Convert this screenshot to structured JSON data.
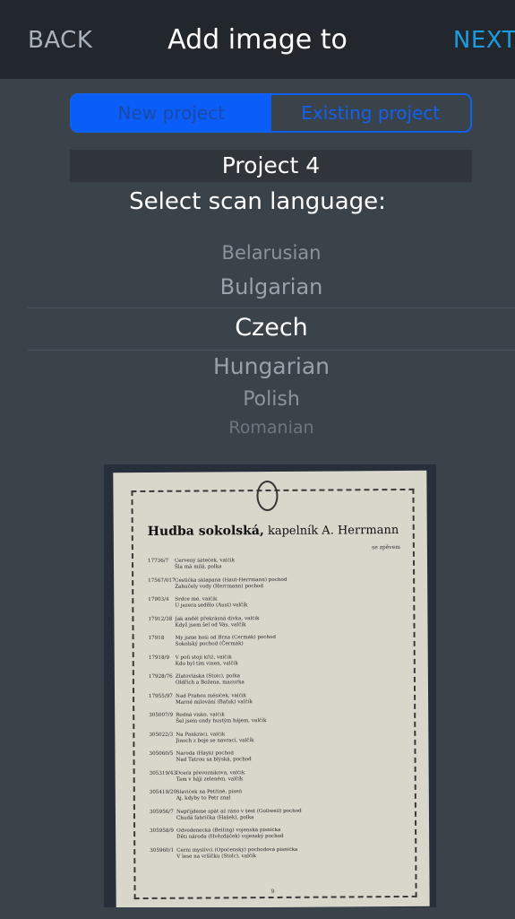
{
  "navbar": {
    "back_label": "BACK",
    "title": "Add image to",
    "next_label": "NEXT"
  },
  "project_type": {
    "options": [
      "New project",
      "Existing project"
    ],
    "selected": "New project"
  },
  "project_name": "Project 4",
  "scan_language": {
    "label": "Select scan language:",
    "items": [
      "Belarusian",
      "Bulgarian",
      "Czech",
      "Hungarian",
      "Polish",
      "Romanian"
    ],
    "selected": "Czech"
  },
  "preview_image": {
    "title_bold": "Hudba sokolská,",
    "title_rest": " kapelník A. Herrmann",
    "subtitle": "se zpěvem",
    "entries": [
      {
        "num": "17736/7",
        "lines": [
          "Červený šáteček, valčík",
          "Šla má milá, polka"
        ]
      },
      {
        "num": "17567/017",
        "lines": [
          "Cestička sklapaná (Haut-Herrmann) pochod",
          "Zahučely vody (Herrmann) pochod"
        ]
      },
      {
        "num": "17903/4",
        "lines": [
          "Srdce mé, valčík",
          "U jezera sedělo (Aust) valčík"
        ]
      },
      {
        "num": "17912/38",
        "lines": [
          "Jak anděl překrásná dívka, valčík",
          "Když jsem šel od Vás, valčík"
        ]
      },
      {
        "num": "17918",
        "lines": [
          "My jsme hoši od Brna (Čermák) pochod",
          "Sokolský pochod (Čermák)"
        ]
      },
      {
        "num": "17918/9",
        "lines": [
          "V poli stojí kříž, valčík",
          "Kdo byl tím vinen, valčík"
        ]
      },
      {
        "num": "17928/76",
        "lines": [
          "Zlatovláska (Stolc), polka",
          "Oldřich a Božena, mazurka"
        ]
      },
      {
        "num": "17955/97",
        "lines": [
          "Nad Prahou měsíček, valčík",
          "Marné milování (Baťuk) valčík"
        ]
      },
      {
        "num": "305007/9",
        "lines": [
          "Rodná vísko, valčík",
          "Šel jsem ondy hustým hájem, valčík"
        ]
      },
      {
        "num": "305022/3",
        "lines": [
          "Na Pankrácí, valčík",
          "Jinoch z boje se navrací, valčík"
        ]
      },
      {
        "num": "305060/5",
        "lines": [
          "Národa (Hayk) pochod",
          "Nad Tatrou sa blýská, pochod"
        ]
      },
      {
        "num": "305319/43",
        "lines": [
          "Dcera převozníkova, valčík",
          "Tam v háji zeleném, valčík"
        ]
      },
      {
        "num": "305419/20",
        "lines": [
          "Slavíček na Petříně, píseň",
          "Aj, kdyby to Petr znal"
        ]
      },
      {
        "num": "305956/7",
        "lines": [
          "Nepřijdeme spát až ráno v šest (Gollwell) pochod",
          "Chudá fabrička (Hašek), polka"
        ]
      },
      {
        "num": "305958/9",
        "lines": [
          "Odvodenecká (Belling) vojenská písnička",
          "Děti národa (Hvězdáček) vojenský pochod"
        ]
      },
      {
        "num": "305960/1",
        "lines": [
          "Černí myslivci (Opočenský) pochodová písnička",
          "V lese na vršíčku (Stolc), valčík"
        ]
      }
    ],
    "page_number": "9"
  }
}
